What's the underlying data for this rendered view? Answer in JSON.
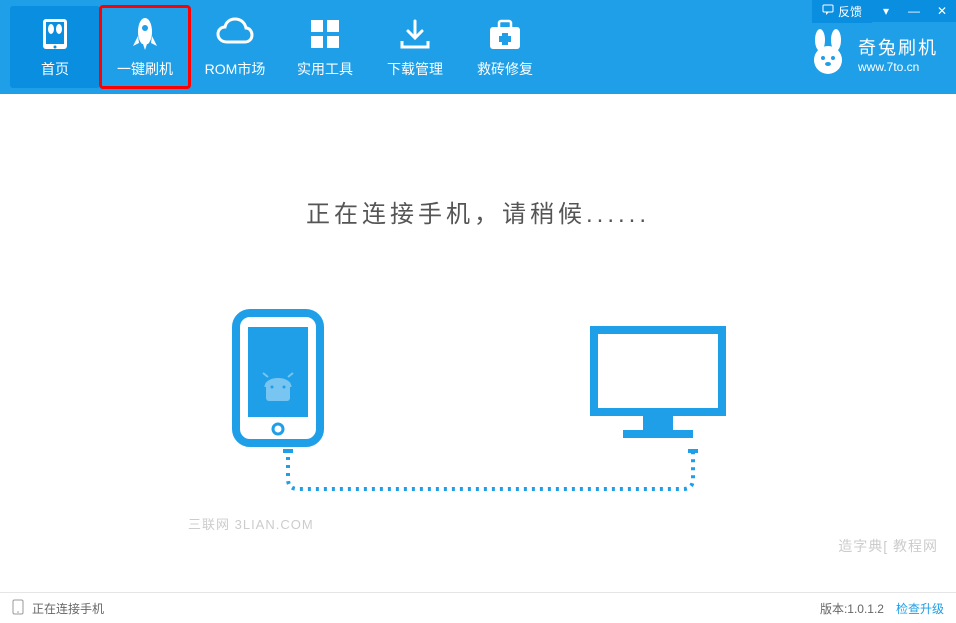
{
  "titlebar": {
    "feedback_label": "反馈"
  },
  "nav": {
    "items": [
      {
        "label": "首页"
      },
      {
        "label": "一键刷机"
      },
      {
        "label": "ROM市场"
      },
      {
        "label": "实用工具"
      },
      {
        "label": "下载管理"
      },
      {
        "label": "救砖修复"
      }
    ]
  },
  "brand": {
    "name": "奇兔刷机",
    "url": "www.7to.cn"
  },
  "main": {
    "status_message": "正在连接手机，请稍候......"
  },
  "watermarks": {
    "left": "三联网 3LIAN.COM",
    "right": "造字典[ 教程网"
  },
  "statusbar": {
    "status_text": "正在连接手机",
    "version_label": "版本:1.0.1.2",
    "update_link": "检查升级"
  },
  "colors": {
    "primary": "#1e9fe8",
    "primary_dark": "#0a8ee0"
  }
}
